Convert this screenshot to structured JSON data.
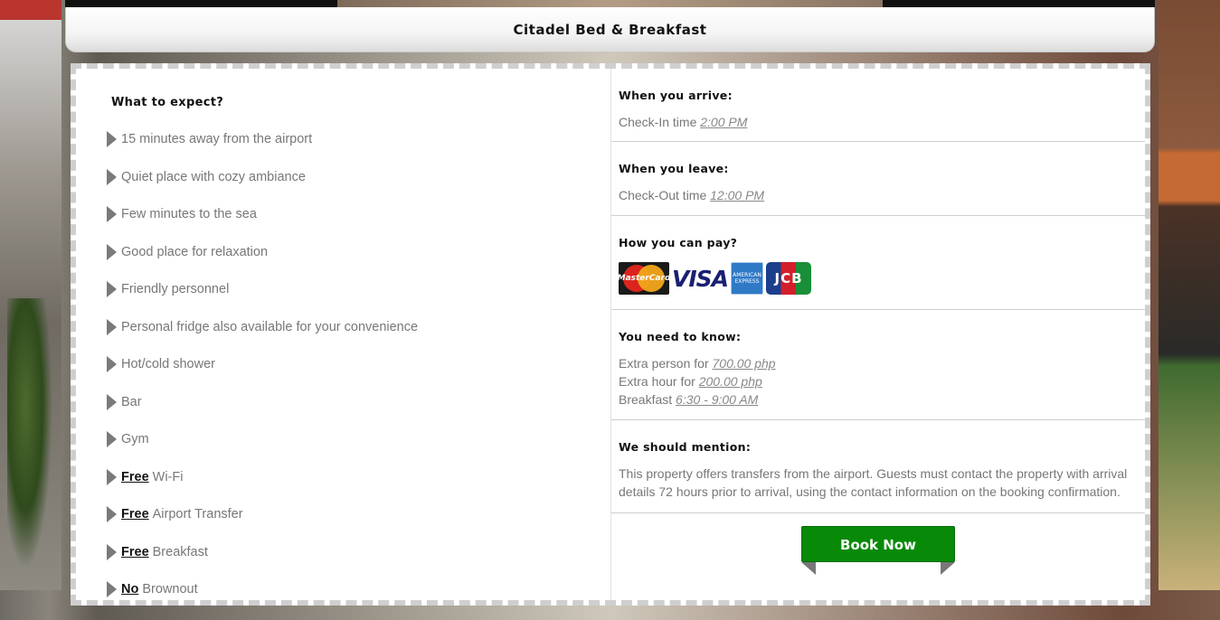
{
  "site_title": "Citadel Bed & Breakfast",
  "expect": {
    "heading": "What to expect?",
    "items": [
      {
        "prefix": "",
        "text": "15 minutes away from the airport"
      },
      {
        "prefix": "",
        "text": "Quiet place with cozy ambiance"
      },
      {
        "prefix": "",
        "text": "Few minutes to the sea"
      },
      {
        "prefix": "",
        "text": "Good place for relaxation"
      },
      {
        "prefix": "",
        "text": "Friendly personnel"
      },
      {
        "prefix": "",
        "text": "Personal fridge also available for your convenience"
      },
      {
        "prefix": "",
        "text": "Hot/cold shower"
      },
      {
        "prefix": "",
        "text": "Bar"
      },
      {
        "prefix": "",
        "text": "Gym"
      },
      {
        "prefix": "Free",
        "text": "Wi-Fi"
      },
      {
        "prefix": "Free",
        "text": "Airport Transfer"
      },
      {
        "prefix": "Free",
        "text": "Breakfast"
      },
      {
        "prefix": "No",
        "text": "Brownout"
      }
    ]
  },
  "arrive": {
    "heading": "When you arrive:",
    "label": "Check-In time",
    "value": "2:00 PM"
  },
  "leave": {
    "heading": "When you leave:",
    "label": "Check-Out time",
    "value": "12:00 PM"
  },
  "pay": {
    "heading": "How you can pay?",
    "cards": {
      "mastercard": "MasterCard",
      "visa": "VISA",
      "amex": "AMERICAN EXPRESS",
      "jcb": "JCB"
    }
  },
  "know": {
    "heading": "You need to know:",
    "lines": [
      {
        "label": "Extra person for",
        "value": "700.00 php"
      },
      {
        "label": "Extra hour for",
        "value": "200.00 php"
      },
      {
        "label": "Breakfast",
        "value": "6:30 - 9:00 AM"
      }
    ]
  },
  "mention": {
    "heading": "We should mention:",
    "text": "This property offers transfers from the airport. Guests must contact the property with arrival details 72 hours prior to arrival, using the contact information on the booking confirmation."
  },
  "book_label": "Book Now"
}
